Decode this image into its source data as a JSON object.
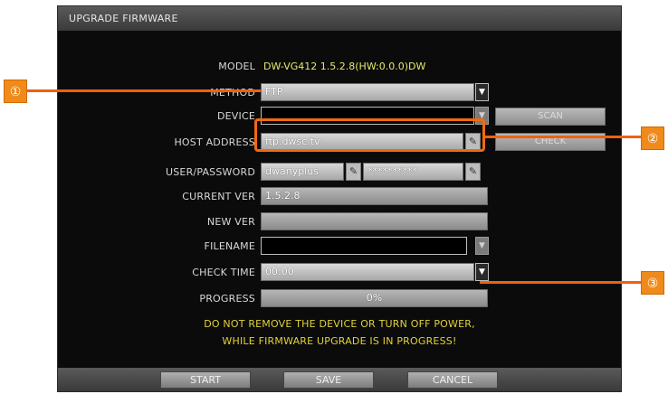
{
  "title": "UPGRADE FIRMWARE",
  "model": {
    "label": "MODEL",
    "value": "DW-VG412 1.5.2.8(HW:0.0.0)DW"
  },
  "method": {
    "label": "METHOD",
    "value": "FTP"
  },
  "device": {
    "label": "DEVICE",
    "value": "",
    "scan_button": "SCAN"
  },
  "host_address": {
    "label": "HOST ADDRESS",
    "value": "ftp.dwsc.tv",
    "check_button": "CHECK"
  },
  "user_password": {
    "label": "USER/PASSWORD",
    "user_value": "dwanyplus",
    "password_value": "**********"
  },
  "current_ver": {
    "label": "CURRENT VER",
    "value": "1.5.2.8"
  },
  "new_ver": {
    "label": "NEW VER",
    "value": ""
  },
  "filename": {
    "label": "FILENAME",
    "value": ""
  },
  "check_time": {
    "label": "CHECK TIME",
    "value": "00:00"
  },
  "progress": {
    "label": "PROGRESS",
    "text": "0%",
    "fraction": 0
  },
  "warning": {
    "line1": "DO NOT REMOVE THE DEVICE OR TURN OFF POWER,",
    "line2": "WHILE FIRMWARE UPGRADE IS IN PROGRESS!"
  },
  "buttons": {
    "start": "START",
    "save": "SAVE",
    "cancel": "CANCEL"
  },
  "callouts": {
    "one": "①",
    "two": "②",
    "three": "③"
  },
  "icons": {
    "dropdown": "dropdown-arrow-icon",
    "edit": "edit-pencil-icon"
  },
  "colors": {
    "callout": "#f08a1a",
    "warning_text": "#e0d23a",
    "model_text": "#e8e870"
  }
}
